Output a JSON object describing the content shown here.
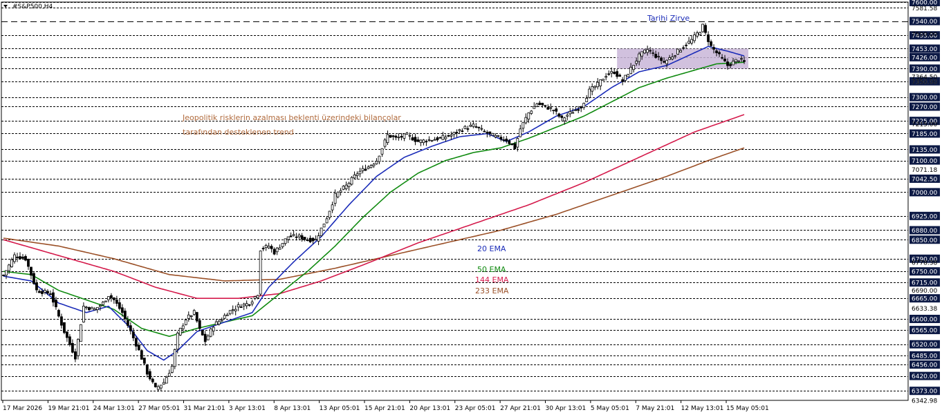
{
  "chart_data": {
    "type": "candlestick",
    "symbol_label": "#S&P500,H4",
    "annotations": {
      "peak": "Tarihi Zirve",
      "trend_line1": "Jeopolitik risklerin azalması beklenti üzerindeki bilançolar",
      "trend_line2": "tarafından desteklenen trend",
      "ema20": "20 EMA",
      "ema50": "50 EMA",
      "ema144": "144 EMA",
      "ema233": "233 EMA"
    },
    "colors": {
      "candle": "#000000",
      "ema20": "#1a2bb8",
      "ema50": "#0f8a0f",
      "ema144": "#d4194a",
      "ema233": "#9a4f26",
      "range_box": "#c9b6d8",
      "peak_text": "#1a2bb8",
      "trend_text": "#b06a3c",
      "axis_label_box": "#0d1a45"
    },
    "ylim": [
      6342.98,
      7600
    ],
    "x_ticks": [
      "17 Mar 2026",
      "19 Mar 21:01",
      "24 Mar 13:01",
      "27 Mar 05:01",
      "31 Mar 21:01",
      "3 Apr 13:01",
      "8 Apr 13:01",
      "13 Apr 05:01",
      "15 Apr 21:01",
      "20 Apr 13:01",
      "23 Apr 05:01",
      "27 Apr 21:01",
      "30 Apr 13:01",
      "5 May 05:01",
      "7 May 21:01",
      "12 May 13:01",
      "15 May 05:01"
    ],
    "y_levels_boxed": [
      7600.0,
      7540.0,
      7495.0,
      7453.0,
      7426.0,
      7390.0,
      7350.0,
      7300.0,
      7270.0,
      7225.0,
      7185.0,
      7135.0,
      7100.0,
      7042.5,
      7000.0,
      6925.0,
      6880.0,
      6850.0,
      6790.0,
      6750.0,
      6715.0,
      6665.0,
      6600.0,
      6565.0,
      6520.0,
      6485.0,
      6456.0,
      6420.0,
      6373.0
    ],
    "y_labels_plain": [
      7581.58,
      7500.0,
      7364.5,
      7350.0,
      7215.0,
      7071.18,
      6778.38,
      6690.0,
      6633.38,
      6342.98
    ],
    "dashed_levels": [
      7600,
      7581.58,
      7540,
      7495,
      7453,
      7426,
      7390,
      7350,
      7300,
      7270,
      7225,
      7185,
      7135,
      7100,
      7042.5,
      7000,
      6925,
      6880,
      6850,
      6790,
      6750,
      6715,
      6665,
      6600,
      6565,
      6520,
      6485,
      6456,
      6420,
      6373
    ],
    "range_box": {
      "top": 7453,
      "bottom": 7390
    },
    "close_anchors": [
      [
        0,
        6738
      ],
      [
        4,
        6800
      ],
      [
        8,
        6790
      ],
      [
        12,
        6690
      ],
      [
        17,
        6680
      ],
      [
        22,
        6560
      ],
      [
        26,
        6480
      ],
      [
        29,
        6640
      ],
      [
        33,
        6630
      ],
      [
        36,
        6650
      ],
      [
        38,
        6675
      ],
      [
        40,
        6660
      ],
      [
        43,
        6620
      ],
      [
        46,
        6560
      ],
      [
        49,
        6500
      ],
      [
        52,
        6430
      ],
      [
        55,
        6380
      ],
      [
        58,
        6400
      ],
      [
        61,
        6450
      ],
      [
        63,
        6550
      ],
      [
        66,
        6600
      ],
      [
        69,
        6620
      ],
      [
        71,
        6565
      ],
      [
        73,
        6530
      ],
      [
        76,
        6580
      ],
      [
        79,
        6600
      ],
      [
        81,
        6620
      ],
      [
        85,
        6640
      ],
      [
        89,
        6650
      ],
      [
        92,
        6680
      ],
      [
        93,
        6820
      ],
      [
        96,
        6830
      ],
      [
        98,
        6810
      ],
      [
        100,
        6830
      ],
      [
        103,
        6860
      ],
      [
        107,
        6860
      ],
      [
        110,
        6850
      ],
      [
        113,
        6850
      ],
      [
        117,
        6920
      ],
      [
        120,
        6990
      ],
      [
        124,
        7020
      ],
      [
        128,
        7060
      ],
      [
        132,
        7080
      ],
      [
        135,
        7100
      ],
      [
        137,
        7140
      ],
      [
        139,
        7180
      ],
      [
        142,
        7170
      ],
      [
        146,
        7180
      ],
      [
        150,
        7160
      ],
      [
        154,
        7165
      ],
      [
        158,
        7170
      ],
      [
        162,
        7180
      ],
      [
        166,
        7200
      ],
      [
        170,
        7210
      ],
      [
        174,
        7190
      ],
      [
        178,
        7175
      ],
      [
        182,
        7165
      ],
      [
        185,
        7140
      ],
      [
        187,
        7200
      ],
      [
        190,
        7250
      ],
      [
        193,
        7280
      ],
      [
        196,
        7270
      ],
      [
        199,
        7260
      ],
      [
        202,
        7230
      ],
      [
        205,
        7250
      ],
      [
        209,
        7270
      ],
      [
        212,
        7320
      ],
      [
        215,
        7340
      ],
      [
        218,
        7370
      ],
      [
        221,
        7380
      ],
      [
        224,
        7350
      ],
      [
        227,
        7390
      ],
      [
        230,
        7430
      ],
      [
        233,
        7450
      ],
      [
        236,
        7430
      ],
      [
        239,
        7410
      ],
      [
        242,
        7430
      ],
      [
        246,
        7460
      ],
      [
        249,
        7480
      ],
      [
        252,
        7510
      ],
      [
        253,
        7525
      ],
      [
        254,
        7500
      ],
      [
        256,
        7460
      ],
      [
        258,
        7440
      ],
      [
        260,
        7420
      ],
      [
        262,
        7400
      ],
      [
        264,
        7410
      ],
      [
        266,
        7420
      ],
      [
        268,
        7410
      ]
    ],
    "ema20_anchors": [
      [
        0,
        6735
      ],
      [
        10,
        6720
      ],
      [
        20,
        6650
      ],
      [
        30,
        6620
      ],
      [
        38,
        6640
      ],
      [
        45,
        6580
      ],
      [
        52,
        6500
      ],
      [
        58,
        6470
      ],
      [
        63,
        6500
      ],
      [
        70,
        6560
      ],
      [
        80,
        6590
      ],
      [
        90,
        6620
      ],
      [
        96,
        6700
      ],
      [
        105,
        6780
      ],
      [
        115,
        6860
      ],
      [
        125,
        6960
      ],
      [
        135,
        7050
      ],
      [
        145,
        7110
      ],
      [
        155,
        7145
      ],
      [
        165,
        7175
      ],
      [
        175,
        7185
      ],
      [
        182,
        7160
      ],
      [
        190,
        7190
      ],
      [
        200,
        7240
      ],
      [
        210,
        7270
      ],
      [
        220,
        7330
      ],
      [
        230,
        7380
      ],
      [
        240,
        7400
      ],
      [
        250,
        7440
      ],
      [
        255,
        7460
      ],
      [
        262,
        7445
      ],
      [
        268,
        7430
      ]
    ],
    "ema50_anchors": [
      [
        0,
        6750
      ],
      [
        10,
        6740
      ],
      [
        20,
        6690
      ],
      [
        30,
        6660
      ],
      [
        40,
        6630
      ],
      [
        50,
        6570
      ],
      [
        60,
        6545
      ],
      [
        70,
        6570
      ],
      [
        80,
        6590
      ],
      [
        90,
        6610
      ],
      [
        100,
        6680
      ],
      [
        110,
        6750
      ],
      [
        120,
        6830
      ],
      [
        130,
        6920
      ],
      [
        140,
        7000
      ],
      [
        150,
        7060
      ],
      [
        160,
        7100
      ],
      [
        170,
        7125
      ],
      [
        180,
        7140
      ],
      [
        190,
        7170
      ],
      [
        200,
        7205
      ],
      [
        210,
        7240
      ],
      [
        220,
        7285
      ],
      [
        230,
        7330
      ],
      [
        240,
        7360
      ],
      [
        250,
        7385
      ],
      [
        258,
        7405
      ],
      [
        268,
        7410
      ]
    ],
    "ema144_anchors": [
      [
        0,
        6850
      ],
      [
        20,
        6800
      ],
      [
        40,
        6750
      ],
      [
        55,
        6700
      ],
      [
        70,
        6665
      ],
      [
        85,
        6665
      ],
      [
        100,
        6680
      ],
      [
        115,
        6720
      ],
      [
        130,
        6770
      ],
      [
        150,
        6840
      ],
      [
        170,
        6900
      ],
      [
        190,
        6960
      ],
      [
        210,
        7030
      ],
      [
        230,
        7110
      ],
      [
        250,
        7190
      ],
      [
        268,
        7245
      ]
    ],
    "ema233_anchors": [
      [
        0,
        6855
      ],
      [
        20,
        6830
      ],
      [
        40,
        6790
      ],
      [
        60,
        6740
      ],
      [
        80,
        6720
      ],
      [
        100,
        6725
      ],
      [
        120,
        6760
      ],
      [
        140,
        6800
      ],
      [
        160,
        6840
      ],
      [
        180,
        6880
      ],
      [
        200,
        6930
      ],
      [
        220,
        6990
      ],
      [
        240,
        7050
      ],
      [
        255,
        7100
      ],
      [
        268,
        7140
      ]
    ]
  }
}
